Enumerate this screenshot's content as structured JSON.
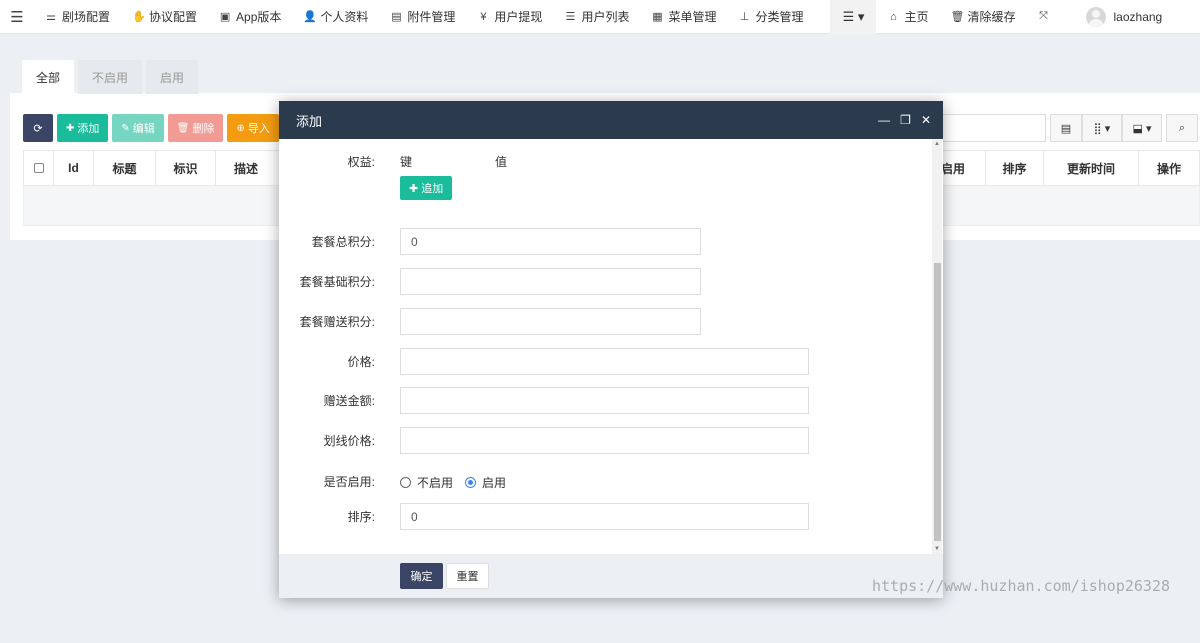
{
  "topnav": {
    "items": [
      {
        "icon": "sliders-icon",
        "glyph": "⚌",
        "label": "剧场配置"
      },
      {
        "icon": "handshake-icon",
        "glyph": "✋",
        "label": "协议配置"
      },
      {
        "icon": "image-icon",
        "glyph": "▣",
        "label": "App版本"
      },
      {
        "icon": "user-icon",
        "glyph": "👤",
        "label": "个人资料"
      },
      {
        "icon": "file-image-icon",
        "glyph": "▤",
        "label": "附件管理"
      },
      {
        "icon": "yen-icon",
        "glyph": "¥",
        "label": "用户提现"
      },
      {
        "icon": "list-icon",
        "glyph": "☰",
        "label": "用户列表"
      },
      {
        "icon": "list-alt-icon",
        "glyph": "▦",
        "label": "菜单管理"
      },
      {
        "icon": "sitemap-icon",
        "glyph": "⊥",
        "label": "分类管理"
      }
    ],
    "home_label": "主页",
    "clear_cache_label": "清除缓存",
    "username": "laozhang"
  },
  "tabs": [
    {
      "label": "全部",
      "active": true
    },
    {
      "label": "不启用",
      "active": false
    },
    {
      "label": "启用",
      "active": false
    }
  ],
  "toolbar": {
    "add_label": "添加",
    "edit_label": "编辑",
    "delete_label": "删除",
    "import_label": "导入",
    "colors": {
      "refresh": "#3a4566",
      "add": "#1abc9c",
      "edit": "#76d6c2",
      "delete": "#f19b94",
      "import": "#f39c12"
    }
  },
  "table": {
    "headers_left": [
      "Id",
      "标题",
      "标识",
      "描述"
    ],
    "headers_right": [
      "启用",
      "排序",
      "更新时间",
      "操作"
    ]
  },
  "modal": {
    "title": "添加",
    "kv": {
      "label": "权益:",
      "key_header": "键",
      "value_header": "值",
      "add_button": "追加"
    },
    "fields": {
      "total_points": {
        "label": "套餐总积分:",
        "value": "0"
      },
      "base_points": {
        "label": "套餐基础积分:",
        "value": ""
      },
      "bonus_points": {
        "label": "套餐赠送积分:",
        "value": ""
      },
      "price": {
        "label": "价格:",
        "value": ""
      },
      "gift_amount": {
        "label": "赠送金额:",
        "value": ""
      },
      "strike_price": {
        "label": "划线价格:",
        "value": ""
      },
      "sort": {
        "label": "排序:",
        "value": "0"
      }
    },
    "enabled": {
      "label": "是否启用:",
      "options": [
        "不启用",
        "启用"
      ],
      "selected": "启用"
    },
    "footer": {
      "ok_label": "确定",
      "reset_label": "重置"
    }
  },
  "watermark": "https://www.huzhan.com/ishop26328"
}
